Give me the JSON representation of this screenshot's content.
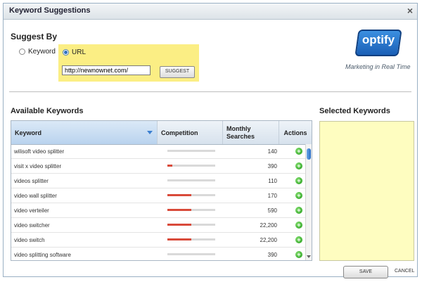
{
  "window": {
    "title": "Keyword Suggestions",
    "close_glyph": "×"
  },
  "suggest": {
    "heading": "Suggest By",
    "keyword_label": "Keyword",
    "url_label": "URL",
    "selected_option": "URL",
    "url_value": "http://newnownet.com/",
    "button_label": "SUGGEST"
  },
  "brand": {
    "logo_text": "optify",
    "tagline": "Marketing in Real Time",
    "accent": "#1a5fb6"
  },
  "available": {
    "heading": "Available Keywords",
    "columns": {
      "keyword": "Keyword",
      "competition": "Competition",
      "monthly": "Monthly Searches",
      "actions": "Actions"
    },
    "rows": [
      {
        "keyword": "wilisoft video splitter",
        "competition": 0.0,
        "searches": "140"
      },
      {
        "keyword": "visit x video splitter",
        "competition": 0.1,
        "searches": "390"
      },
      {
        "keyword": "videos splitter",
        "competition": 0.0,
        "searches": "110"
      },
      {
        "keyword": "video wall splitter",
        "competition": 0.5,
        "searches": "170"
      },
      {
        "keyword": "video verteiler",
        "competition": 0.5,
        "searches": "590"
      },
      {
        "keyword": "video switcher",
        "competition": 0.5,
        "searches": "22,200"
      },
      {
        "keyword": "video switch",
        "competition": 0.5,
        "searches": "22,200"
      },
      {
        "keyword": "video splitting software",
        "competition": 0.0,
        "searches": "390"
      }
    ]
  },
  "selected": {
    "heading": "Selected Keywords"
  },
  "footer": {
    "save_label": "SAVE",
    "cancel_label": "CANCEL"
  },
  "colors": {
    "competition_fill": "#d94a3a",
    "selected_bg": "#fefdc0",
    "url_highlight": "#fbee84"
  }
}
